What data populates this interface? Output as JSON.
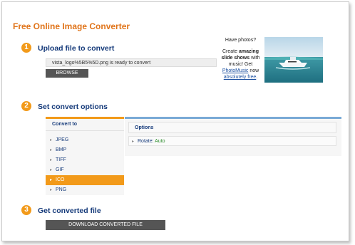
{
  "page_title": "Free Online Image Converter",
  "steps": [
    {
      "number": "1",
      "title": "Upload file to convert"
    },
    {
      "number": "2",
      "title": "Set convert options"
    },
    {
      "number": "3",
      "title": "Get converted file"
    }
  ],
  "upload": {
    "status_text": "vista_logo%5B5%5D.png is ready to convert",
    "browse_label": "BROWSE"
  },
  "promo": {
    "line1": "Have photos?",
    "line2a": "Create ",
    "line2b": "amazing slide shows",
    "line2c": " with music! Get ",
    "link1": "PhotoMusic",
    "line3": " now ",
    "link2": "absolutely free",
    "line4": "."
  },
  "convert_to": {
    "header": "Convert to",
    "formats": [
      "JPEG",
      "BMP",
      "TIFF",
      "GIF",
      "ICO",
      "PNG"
    ],
    "selected": "ICO"
  },
  "options": {
    "header": "Options",
    "rotate_label": "Rotate:",
    "rotate_value": "Auto"
  },
  "download": {
    "label": "DOWNLOAD CONVERTED FILE"
  },
  "colors": {
    "accent_orange": "#f29a1a",
    "title_orange": "#e0741a",
    "heading_blue": "#153a7a",
    "options_bar_blue": "#7aaad6",
    "button_gray": "#555555"
  }
}
